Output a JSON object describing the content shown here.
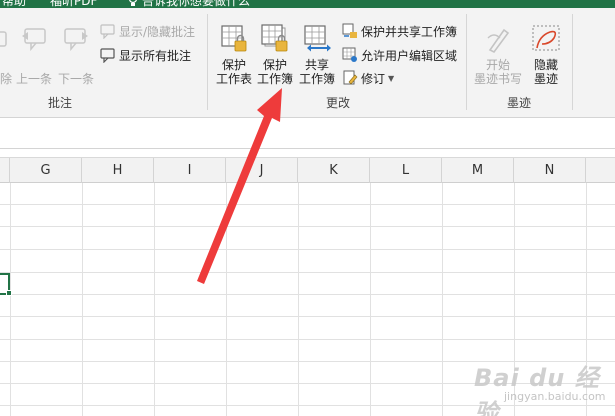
{
  "tabs": {
    "help": "帮助",
    "pdf": "福昕PDF",
    "tell_me": "告诉我你想要做什么"
  },
  "ribbon": {
    "comments_group": {
      "label": "批注",
      "delete_label": "除",
      "previous_label": "上一条",
      "next_label": "下一条",
      "show_hide_label": "显示/隐藏批注",
      "show_all_label": "显示所有批注"
    },
    "changes_group": {
      "label": "更改",
      "protect_sheet": [
        "保护",
        "工作表"
      ],
      "protect_workbook": [
        "保护",
        "工作簿"
      ],
      "share_workbook": [
        "共享",
        "工作簿"
      ],
      "protect_share": "保护并共享工作簿",
      "allow_edit_ranges": "允许用户编辑区域",
      "track_changes": "修订"
    },
    "ink_group": {
      "label": "墨迹",
      "start_inking": [
        "开始",
        "墨迹书写"
      ],
      "hide_ink": [
        "隐藏",
        "墨迹"
      ]
    }
  },
  "sheet": {
    "columns": [
      "G",
      "H",
      "I",
      "J",
      "K",
      "L",
      "M",
      "N"
    ]
  },
  "watermark": {
    "main": "Bai du 经验",
    "sub": "jingyan.baidu.com"
  },
  "colors": {
    "excel_green": "#217346",
    "arrow_red": "#ee3b3b",
    "ribbon_bg": "#f3f3f3",
    "lock_gold": "#e9b53e",
    "share_blue": "#2b78c9"
  },
  "icons": {
    "protect_sheet": "lock-sheet-icon",
    "protect_workbook": "lock-workbook-icon",
    "share_workbook": "share-workbook-icon",
    "start_inking": "pen-icon",
    "hide_ink": "hide-ink-icon"
  }
}
